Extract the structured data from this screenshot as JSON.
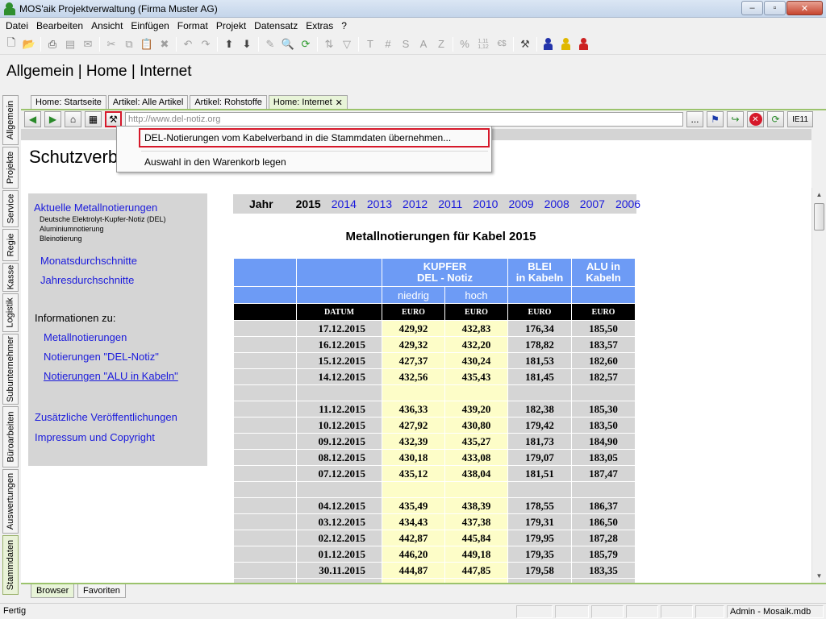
{
  "window": {
    "title": "MOS'aik Projektverwaltung (Firma Muster AG)",
    "minimize": "–",
    "maximize": "▫",
    "close": "✕"
  },
  "menu": [
    "Datei",
    "Bearbeiten",
    "Ansicht",
    "Einfügen",
    "Format",
    "Projekt",
    "Datensatz",
    "Extras",
    "?"
  ],
  "toolbar": {
    "icons": [
      "new-document-icon",
      "open-folder-icon",
      "print-icon",
      "print-preview-icon",
      "cut-icon",
      "copy-icon",
      "paste-icon",
      "delete-icon",
      "arrow-up-icon",
      "arrow-down-icon",
      "undo-icon",
      "redo-icon",
      "edit-icon",
      "search-icon",
      "refresh-icon",
      "sort-icon",
      "filter-icon",
      "text-format-icon",
      "number-format-icon",
      "percent-icon",
      "decimal-icon",
      "currency-icon",
      "tools-icon",
      "user-blue-icon",
      "user-yellow-icon",
      "user-red-icon"
    ],
    "t_label": "T",
    "hash_label": "#",
    "s_label": "S",
    "a_label": "A",
    "z_label": "Z",
    "percent_label": "%",
    "decimals_label": "1,11 1,12",
    "currency_label": "€$"
  },
  "heading": "Allgemein  |  Home  |  Internet",
  "side_tabs": [
    "Allgemein",
    "Projekte",
    "Service",
    "Regie",
    "Kasse",
    "Logistik",
    "Subunternehmer",
    "Büroarbeiten",
    "Auswertungen",
    "Stammdaten"
  ],
  "browser_tabs": [
    {
      "label": "Home: Startseite",
      "active": false
    },
    {
      "label": "Artikel: Alle Artikel",
      "active": false
    },
    {
      "label": "Artikel: Rohstoffe",
      "active": false
    },
    {
      "label": "Home: Internet",
      "active": true
    }
  ],
  "nav": {
    "url": "http://www.del-notiz.org",
    "more_label": "...",
    "ie_label": "IE11"
  },
  "dropdown": {
    "item1": "DEL-Notierungen vom Kabelverband in die Stammdaten übernehmen...",
    "item2": "Auswahl in den Warenkorb legen"
  },
  "page": {
    "title": "Schutzverband",
    "left": {
      "link_main": "Aktuelle Metallnotierungen",
      "sub1": "Deutsche Elektrolyt-Kupfer-Notiz (DEL)",
      "sub2": "Aluminiumnotierung",
      "sub3": "Bleinotierung",
      "monthly": "Monatsdurchschnitte",
      "yearly": "Jahresdurchschnitte",
      "info_label": "Informationen zu:",
      "info1": "Metallnotierungen",
      "info2": "Notierungen \"DEL-Notiz\"",
      "info3": "Notierungen \"ALU in Kabeln\"",
      "extra1": "Zusätzliche Veröffentlichungen",
      "extra2": "Impressum und Copyright"
    },
    "years": {
      "label": "Jahr",
      "current": "2015",
      "others": [
        "2014",
        "2013",
        "2012",
        "2011",
        "2010",
        "2009",
        "2008",
        "2007",
        "2006"
      ]
    },
    "table_title": "Metallnotierungen für Kabel 2015",
    "table": {
      "h_kupfer": "KUPFER",
      "h_kupfer2": "DEL - Notiz",
      "h_blei": "BLEI",
      "h_blei2": "in Kabeln",
      "h_alu": "ALU in",
      "h_alu2": "Kabeln",
      "sub_low": "niedrig",
      "sub_high": "hoch",
      "u_date": "DATUM",
      "u_euro": "EURO",
      "rows": [
        [
          "17.12.2015",
          "429,92",
          "432,83",
          "176,34",
          "185,50"
        ],
        [
          "16.12.2015",
          "429,32",
          "432,20",
          "178,82",
          "183,57"
        ],
        [
          "15.12.2015",
          "427,37",
          "430,24",
          "181,53",
          "182,60"
        ],
        [
          "14.12.2015",
          "432,56",
          "435,43",
          "181,45",
          "182,57"
        ],
        [
          "",
          "",
          "",
          "",
          ""
        ],
        [
          "11.12.2015",
          "436,33",
          "439,20",
          "182,38",
          "185,30"
        ],
        [
          "10.12.2015",
          "427,92",
          "430,80",
          "179,42",
          "183,50"
        ],
        [
          "09.12.2015",
          "432,39",
          "435,27",
          "181,73",
          "184,90"
        ],
        [
          "08.12.2015",
          "430,18",
          "433,08",
          "179,07",
          "183,05"
        ],
        [
          "07.12.2015",
          "435,12",
          "438,04",
          "181,51",
          "187,47"
        ],
        [
          "",
          "",
          "",
          "",
          ""
        ],
        [
          "04.12.2015",
          "435,49",
          "438,39",
          "178,55",
          "186,37"
        ],
        [
          "03.12.2015",
          "434,43",
          "437,38",
          "179,31",
          "186,50"
        ],
        [
          "02.12.2015",
          "442,87",
          "445,84",
          "179,95",
          "187,28"
        ],
        [
          "01.12.2015",
          "446,20",
          "449,18",
          "179,35",
          "185,79"
        ],
        [
          "30.11.2015",
          "444,87",
          "447,85",
          "179,58",
          "183,35"
        ],
        [
          "",
          "",
          "",
          "",
          ""
        ]
      ]
    }
  },
  "bottom_tabs": [
    {
      "label": "Browser",
      "active": true
    },
    {
      "label": "Favoriten",
      "active": false
    }
  ],
  "status": {
    "left": "Fertig",
    "right": "Admin - Mosaik.mdb"
  },
  "colors": {
    "accent_green": "#9bc36c",
    "highlight_red": "#d6182a",
    "table_blue": "#6d9bf5",
    "link_blue": "#1a1adc"
  }
}
